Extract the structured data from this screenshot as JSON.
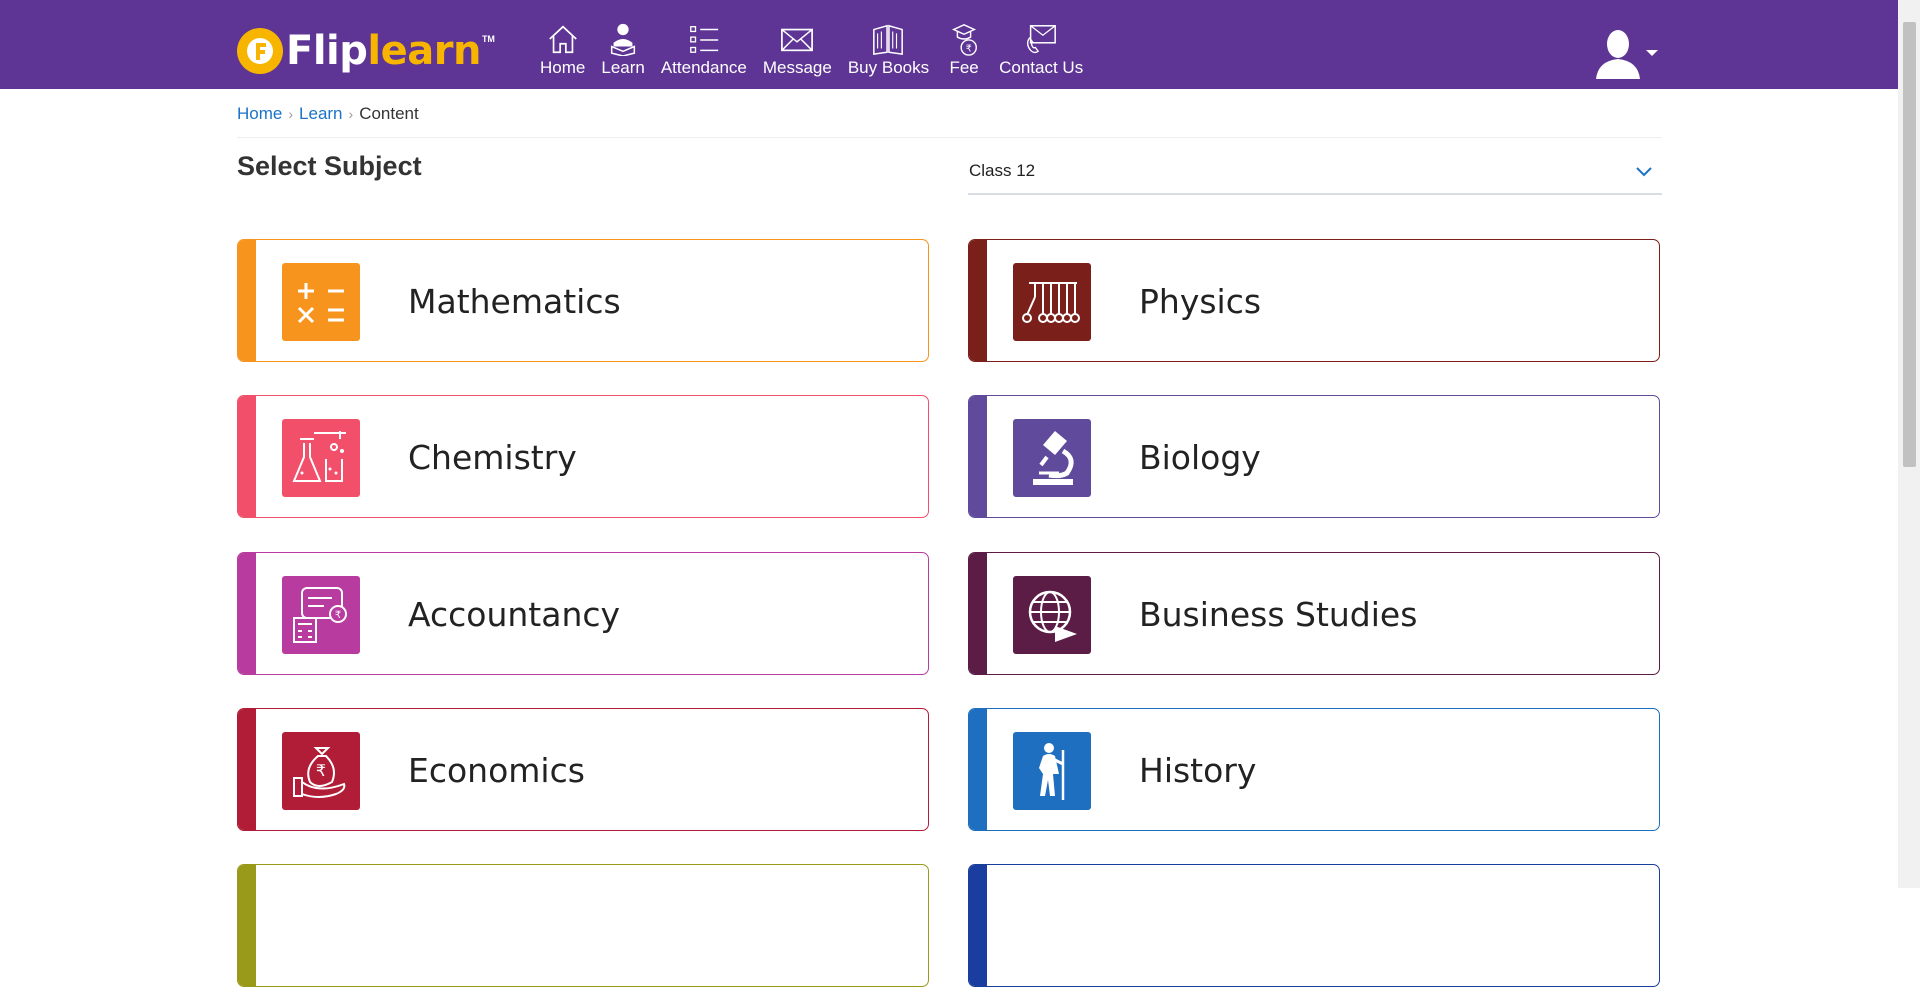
{
  "brand": {
    "flip": "Flip",
    "learn": "learn",
    "tm": "TM"
  },
  "nav": [
    {
      "label": "Home",
      "icon": "home-icon"
    },
    {
      "label": "Learn",
      "icon": "learn-icon"
    },
    {
      "label": "Attendance",
      "icon": "attendance-list-icon"
    },
    {
      "label": "Message",
      "icon": "envelope-icon"
    },
    {
      "label": "Buy Books",
      "icon": "books-icon"
    },
    {
      "label": "Fee",
      "icon": "fee-icon"
    },
    {
      "label": "Contact Us",
      "icon": "contact-icon"
    }
  ],
  "breadcrumb": {
    "home": "Home",
    "learn": "Learn",
    "current": "Content"
  },
  "page": {
    "title": "Select Subject"
  },
  "class_select": {
    "value": "Class 12"
  },
  "subjects": [
    {
      "name": "Mathematics",
      "color": "#f7941d",
      "icon": "math-operators-icon"
    },
    {
      "name": "Physics",
      "color": "#7b1f1a",
      "icon": "newtons-cradle-icon"
    },
    {
      "name": "Chemistry",
      "color": "#f24f6b",
      "icon": "flask-icon"
    },
    {
      "name": "Biology",
      "color": "#5f4a9c",
      "icon": "microscope-icon"
    },
    {
      "name": "Accountancy",
      "color": "#b83ba0",
      "icon": "calculator-icon"
    },
    {
      "name": "Business Studies",
      "color": "#5b1d45",
      "icon": "globe-icon"
    },
    {
      "name": "Economics",
      "color": "#b11d36",
      "icon": "money-bag-icon"
    },
    {
      "name": "History",
      "color": "#1e6fbf",
      "icon": "walking-man-icon"
    },
    {
      "name": "",
      "color": "#9a9a1a",
      "icon": "subject-icon"
    },
    {
      "name": "",
      "color": "#1a3da0",
      "icon": "subject-icon"
    }
  ]
}
